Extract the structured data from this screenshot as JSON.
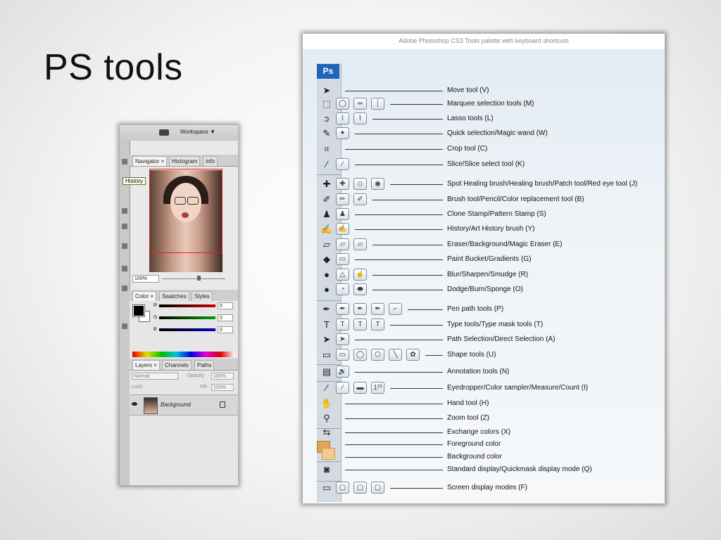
{
  "slide": {
    "title": "PS tools"
  },
  "panels": {
    "workspace_label": "Workspace ▼",
    "tooltip": "History",
    "nav_tabs": [
      "Navigator ×",
      "Histogram",
      "Info"
    ],
    "zoom_value": "100%",
    "color_tabs": [
      "Color ×",
      "Swatches",
      "Styles"
    ],
    "channels": [
      {
        "label": "R",
        "value": "0",
        "color": "#d00000"
      },
      {
        "label": "G",
        "value": "0",
        "color": "#00a000"
      },
      {
        "label": "B",
        "value": "0",
        "color": "#0000c0"
      }
    ],
    "layers_tabs": [
      "Layers ×",
      "Channels",
      "Paths"
    ],
    "blend_mode": "Normal",
    "opacity_label": "Opacity:",
    "opacity_value": "100%",
    "lock_label": "Lock:",
    "fill_label": "Fill:",
    "fill_value": "100%",
    "layer_name": "Background"
  },
  "tools_ref": {
    "header": "Adobe Photoshop CS3 Tools palette with keyboard shortcuts",
    "logo": "Ps",
    "tools": [
      {
        "label": "Move tool (V)",
        "icon": "move-icon",
        "glyph": "➤",
        "subs": []
      },
      {
        "label": "Marquee selection tools (M)",
        "icon": "marquee-icon",
        "glyph": "⬚",
        "subs": [
          "◯",
          "═",
          "┊"
        ]
      },
      {
        "label": "Lasso tools (L)",
        "icon": "lasso-icon",
        "glyph": "ↄ",
        "subs": [
          "⌇",
          "⌇"
        ]
      },
      {
        "label": "Quick selection/Magic wand (W)",
        "icon": "quick-selection-icon",
        "glyph": "✎",
        "subs": [
          "✦"
        ]
      },
      {
        "label": "Crop tool (C)",
        "icon": "crop-icon",
        "glyph": "⌗",
        "subs": []
      },
      {
        "label": "Slice/Slice select tool (K)",
        "icon": "slice-icon",
        "glyph": "⁄",
        "subs": [
          "⁄"
        ]
      },
      {
        "label": "Spot Healing brush/Healing brush/Patch tool/Red eye tool (J)",
        "icon": "healing-brush-icon",
        "glyph": "✚",
        "subs": [
          "✚",
          "◇",
          "◉"
        ]
      },
      {
        "label": "Brush tool/Pencil/Color replacement tool (B)",
        "icon": "brush-icon",
        "glyph": "✐",
        "subs": [
          "✏",
          "✐"
        ]
      },
      {
        "label": "Clone Stamp/Pattern Stamp (S)",
        "icon": "clone-stamp-icon",
        "glyph": "♟",
        "subs": [
          "♟"
        ]
      },
      {
        "label": "History/Art History brush (Y)",
        "icon": "history-brush-icon",
        "glyph": "✍",
        "subs": [
          "✍"
        ]
      },
      {
        "label": "Eraser/Background/Magic Eraser (E)",
        "icon": "eraser-icon",
        "glyph": "▱",
        "subs": [
          "▱",
          "▱"
        ]
      },
      {
        "label": "Paint Bucket/Gradients (G)",
        "icon": "paint-bucket-icon",
        "glyph": "◆",
        "subs": [
          "▭"
        ]
      },
      {
        "label": "Blur/Sharpen/Smudge (R)",
        "icon": "blur-icon",
        "glyph": "●",
        "subs": [
          "△",
          "☝"
        ]
      },
      {
        "label": "Dodge/Burn/Sponge (O)",
        "icon": "dodge-icon",
        "glyph": "●",
        "subs": [
          "◔",
          "⬬"
        ]
      },
      {
        "label": "Pen path tools (P)",
        "icon": "pen-icon",
        "glyph": "✒",
        "subs": [
          "✒",
          "✒",
          "✒",
          "⌐"
        ]
      },
      {
        "label": "Type tools/Type mask tools (T)",
        "icon": "type-icon",
        "glyph": "T",
        "subs": [
          "T",
          "T",
          "T"
        ]
      },
      {
        "label": "Path Selection/Direct Selection (A)",
        "icon": "path-selection-icon",
        "glyph": "➤",
        "subs": [
          "➤"
        ]
      },
      {
        "label": "Shape tools (U)",
        "icon": "shape-icon",
        "glyph": "▭",
        "subs": [
          "▭",
          "◯",
          "⬡",
          "╲",
          "✿"
        ]
      },
      {
        "label": "Annotation tools (N)",
        "icon": "annotation-icon",
        "glyph": "▤",
        "subs": [
          "🔊"
        ]
      },
      {
        "label": "Eyedropper/Color sampler/Measure/Count (I)",
        "icon": "eyedropper-icon",
        "glyph": "⁄",
        "subs": [
          "⁄",
          "▬",
          "1²³"
        ]
      },
      {
        "label": "Hand tool (H)",
        "icon": "hand-icon",
        "glyph": "✋",
        "subs": []
      },
      {
        "label": "Zoom tool (Z)",
        "icon": "zoom-icon",
        "glyph": "⚲",
        "subs": []
      },
      {
        "label": "Exchange colors (X)",
        "icon": "exchange-colors-icon",
        "glyph": "⇆",
        "subs": []
      },
      {
        "label": "Foreground color",
        "icon": "foreground-color-icon",
        "glyph": "",
        "subs": []
      },
      {
        "label": "Background color",
        "icon": "background-color-icon",
        "glyph": "",
        "subs": []
      },
      {
        "label": "Standard display/Quickmask display mode (Q)",
        "icon": "quickmask-icon",
        "glyph": "◙",
        "subs": []
      },
      {
        "label": "Screen display modes (F)",
        "icon": "screen-mode-icon",
        "glyph": "▭",
        "subs": [
          "▢",
          "▢",
          "▢"
        ]
      }
    ],
    "colors": {
      "foreground": "#e0a657",
      "background": "#f3c98c",
      "logo": "#1f64b8"
    }
  }
}
